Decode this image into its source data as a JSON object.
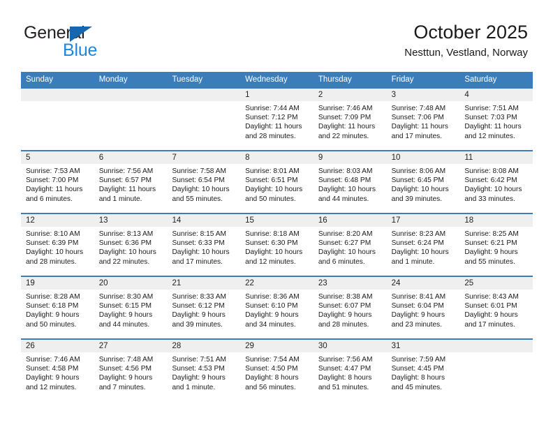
{
  "brand": {
    "name_part1": "General",
    "name_part2": "Blue",
    "accent_color": "#1f87d8",
    "triangle_color": "#1666b0"
  },
  "header": {
    "title": "October 2025",
    "subtitle": "Nesttun, Vestland, Norway"
  },
  "calendar": {
    "header_color": "#3a7dba",
    "weekdays": [
      "Sunday",
      "Monday",
      "Tuesday",
      "Wednesday",
      "Thursday",
      "Friday",
      "Saturday"
    ],
    "weeks": [
      [
        {
          "date": "",
          "sunrise": "",
          "sunset": "",
          "daylight_line1": "",
          "daylight_line2": ""
        },
        {
          "date": "",
          "sunrise": "",
          "sunset": "",
          "daylight_line1": "",
          "daylight_line2": ""
        },
        {
          "date": "",
          "sunrise": "",
          "sunset": "",
          "daylight_line1": "",
          "daylight_line2": ""
        },
        {
          "date": "1",
          "sunrise": "Sunrise: 7:44 AM",
          "sunset": "Sunset: 7:12 PM",
          "daylight_line1": "Daylight: 11 hours",
          "daylight_line2": "and 28 minutes."
        },
        {
          "date": "2",
          "sunrise": "Sunrise: 7:46 AM",
          "sunset": "Sunset: 7:09 PM",
          "daylight_line1": "Daylight: 11 hours",
          "daylight_line2": "and 22 minutes."
        },
        {
          "date": "3",
          "sunrise": "Sunrise: 7:48 AM",
          "sunset": "Sunset: 7:06 PM",
          "daylight_line1": "Daylight: 11 hours",
          "daylight_line2": "and 17 minutes."
        },
        {
          "date": "4",
          "sunrise": "Sunrise: 7:51 AM",
          "sunset": "Sunset: 7:03 PM",
          "daylight_line1": "Daylight: 11 hours",
          "daylight_line2": "and 12 minutes."
        }
      ],
      [
        {
          "date": "5",
          "sunrise": "Sunrise: 7:53 AM",
          "sunset": "Sunset: 7:00 PM",
          "daylight_line1": "Daylight: 11 hours",
          "daylight_line2": "and 6 minutes."
        },
        {
          "date": "6",
          "sunrise": "Sunrise: 7:56 AM",
          "sunset": "Sunset: 6:57 PM",
          "daylight_line1": "Daylight: 11 hours",
          "daylight_line2": "and 1 minute."
        },
        {
          "date": "7",
          "sunrise": "Sunrise: 7:58 AM",
          "sunset": "Sunset: 6:54 PM",
          "daylight_line1": "Daylight: 10 hours",
          "daylight_line2": "and 55 minutes."
        },
        {
          "date": "8",
          "sunrise": "Sunrise: 8:01 AM",
          "sunset": "Sunset: 6:51 PM",
          "daylight_line1": "Daylight: 10 hours",
          "daylight_line2": "and 50 minutes."
        },
        {
          "date": "9",
          "sunrise": "Sunrise: 8:03 AM",
          "sunset": "Sunset: 6:48 PM",
          "daylight_line1": "Daylight: 10 hours",
          "daylight_line2": "and 44 minutes."
        },
        {
          "date": "10",
          "sunrise": "Sunrise: 8:06 AM",
          "sunset": "Sunset: 6:45 PM",
          "daylight_line1": "Daylight: 10 hours",
          "daylight_line2": "and 39 minutes."
        },
        {
          "date": "11",
          "sunrise": "Sunrise: 8:08 AM",
          "sunset": "Sunset: 6:42 PM",
          "daylight_line1": "Daylight: 10 hours",
          "daylight_line2": "and 33 minutes."
        }
      ],
      [
        {
          "date": "12",
          "sunrise": "Sunrise: 8:10 AM",
          "sunset": "Sunset: 6:39 PM",
          "daylight_line1": "Daylight: 10 hours",
          "daylight_line2": "and 28 minutes."
        },
        {
          "date": "13",
          "sunrise": "Sunrise: 8:13 AM",
          "sunset": "Sunset: 6:36 PM",
          "daylight_line1": "Daylight: 10 hours",
          "daylight_line2": "and 22 minutes."
        },
        {
          "date": "14",
          "sunrise": "Sunrise: 8:15 AM",
          "sunset": "Sunset: 6:33 PM",
          "daylight_line1": "Daylight: 10 hours",
          "daylight_line2": "and 17 minutes."
        },
        {
          "date": "15",
          "sunrise": "Sunrise: 8:18 AM",
          "sunset": "Sunset: 6:30 PM",
          "daylight_line1": "Daylight: 10 hours",
          "daylight_line2": "and 12 minutes."
        },
        {
          "date": "16",
          "sunrise": "Sunrise: 8:20 AM",
          "sunset": "Sunset: 6:27 PM",
          "daylight_line1": "Daylight: 10 hours",
          "daylight_line2": "and 6 minutes."
        },
        {
          "date": "17",
          "sunrise": "Sunrise: 8:23 AM",
          "sunset": "Sunset: 6:24 PM",
          "daylight_line1": "Daylight: 10 hours",
          "daylight_line2": "and 1 minute."
        },
        {
          "date": "18",
          "sunrise": "Sunrise: 8:25 AM",
          "sunset": "Sunset: 6:21 PM",
          "daylight_line1": "Daylight: 9 hours",
          "daylight_line2": "and 55 minutes."
        }
      ],
      [
        {
          "date": "19",
          "sunrise": "Sunrise: 8:28 AM",
          "sunset": "Sunset: 6:18 PM",
          "daylight_line1": "Daylight: 9 hours",
          "daylight_line2": "and 50 minutes."
        },
        {
          "date": "20",
          "sunrise": "Sunrise: 8:30 AM",
          "sunset": "Sunset: 6:15 PM",
          "daylight_line1": "Daylight: 9 hours",
          "daylight_line2": "and 44 minutes."
        },
        {
          "date": "21",
          "sunrise": "Sunrise: 8:33 AM",
          "sunset": "Sunset: 6:12 PM",
          "daylight_line1": "Daylight: 9 hours",
          "daylight_line2": "and 39 minutes."
        },
        {
          "date": "22",
          "sunrise": "Sunrise: 8:36 AM",
          "sunset": "Sunset: 6:10 PM",
          "daylight_line1": "Daylight: 9 hours",
          "daylight_line2": "and 34 minutes."
        },
        {
          "date": "23",
          "sunrise": "Sunrise: 8:38 AM",
          "sunset": "Sunset: 6:07 PM",
          "daylight_line1": "Daylight: 9 hours",
          "daylight_line2": "and 28 minutes."
        },
        {
          "date": "24",
          "sunrise": "Sunrise: 8:41 AM",
          "sunset": "Sunset: 6:04 PM",
          "daylight_line1": "Daylight: 9 hours",
          "daylight_line2": "and 23 minutes."
        },
        {
          "date": "25",
          "sunrise": "Sunrise: 8:43 AM",
          "sunset": "Sunset: 6:01 PM",
          "daylight_line1": "Daylight: 9 hours",
          "daylight_line2": "and 17 minutes."
        }
      ],
      [
        {
          "date": "26",
          "sunrise": "Sunrise: 7:46 AM",
          "sunset": "Sunset: 4:58 PM",
          "daylight_line1": "Daylight: 9 hours",
          "daylight_line2": "and 12 minutes."
        },
        {
          "date": "27",
          "sunrise": "Sunrise: 7:48 AM",
          "sunset": "Sunset: 4:56 PM",
          "daylight_line1": "Daylight: 9 hours",
          "daylight_line2": "and 7 minutes."
        },
        {
          "date": "28",
          "sunrise": "Sunrise: 7:51 AM",
          "sunset": "Sunset: 4:53 PM",
          "daylight_line1": "Daylight: 9 hours",
          "daylight_line2": "and 1 minute."
        },
        {
          "date": "29",
          "sunrise": "Sunrise: 7:54 AM",
          "sunset": "Sunset: 4:50 PM",
          "daylight_line1": "Daylight: 8 hours",
          "daylight_line2": "and 56 minutes."
        },
        {
          "date": "30",
          "sunrise": "Sunrise: 7:56 AM",
          "sunset": "Sunset: 4:47 PM",
          "daylight_line1": "Daylight: 8 hours",
          "daylight_line2": "and 51 minutes."
        },
        {
          "date": "31",
          "sunrise": "Sunrise: 7:59 AM",
          "sunset": "Sunset: 4:45 PM",
          "daylight_line1": "Daylight: 8 hours",
          "daylight_line2": "and 45 minutes."
        },
        {
          "date": "",
          "sunrise": "",
          "sunset": "",
          "daylight_line1": "",
          "daylight_line2": ""
        }
      ]
    ]
  }
}
